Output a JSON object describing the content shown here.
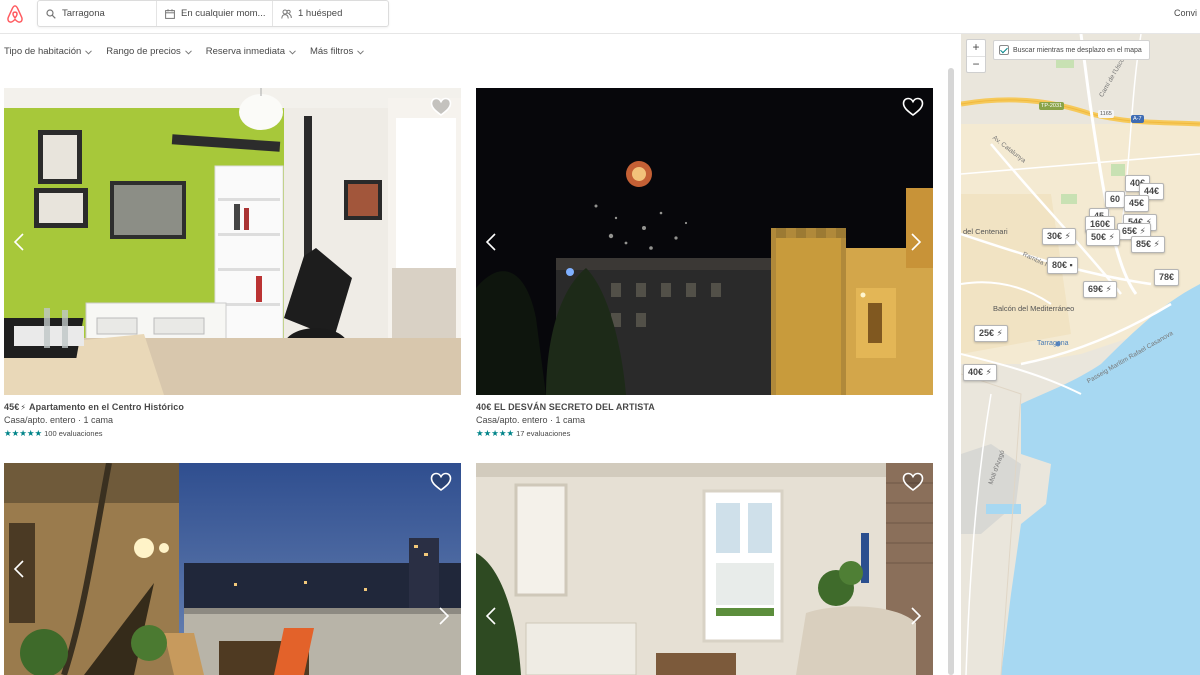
{
  "header": {
    "search": {
      "location": "Tarragona",
      "dates": "En cualquier mom...",
      "guests": "1 huésped"
    },
    "right_link": "Convi"
  },
  "filters": [
    {
      "label": "Tipo de habitación"
    },
    {
      "label": "Rango de precios"
    },
    {
      "label": "Reserva inmediata"
    },
    {
      "label": "Más filtros"
    }
  ],
  "listings": [
    {
      "price": "45€",
      "instant": true,
      "title": "Apartamento en el Centro Histórico",
      "type_beds": "Casa/apto. entero · 1 cama",
      "stars": "★★★★★",
      "reviews": "100 evaluaciones"
    },
    {
      "price": "40€",
      "instant": false,
      "title": "EL DESVÁN SECRETO DEL ARTISTA",
      "type_beds": "Casa/apto. entero · 1 cama",
      "stars": "★★★★★",
      "reviews": "17 evaluaciones"
    },
    {
      "title": ""
    },
    {
      "title": ""
    }
  ],
  "map": {
    "zoom_in": "+",
    "zoom_out": "−",
    "search_toggle": "Buscar mientras me desplazo en el mapa",
    "search_toggle_checked": true,
    "pins": [
      {
        "label": "40€"
      },
      {
        "label": "44€"
      },
      {
        "label": "60"
      },
      {
        "label": "45€"
      },
      {
        "label": "45"
      },
      {
        "label": "54€ ⚡"
      },
      {
        "label": "160€"
      },
      {
        "label": "65€ ⚡"
      },
      {
        "label": "30€ ⚡"
      },
      {
        "label": "50€ ⚡"
      },
      {
        "label": "85€ ⚡"
      },
      {
        "label": "80€ ▪"
      },
      {
        "label": "78€"
      },
      {
        "label": "69€ ⚡"
      },
      {
        "label": "25€ ⚡"
      },
      {
        "label": "40€ ⚡"
      }
    ],
    "labels": {
      "centenari": "del Centenari",
      "balcon": "Balcón del Mediterráneo",
      "tarragona": "Tarragona",
      "rambla": "Rambla Nova",
      "catalunya": "Av. Catalunya",
      "uscola": "Camí de l'Uscola",
      "moll": "Moll d'Aragó",
      "passeig": "Passeig Marítim Rafael Casanova",
      "tp2031": "TP-2031",
      "a7": "A-7",
      "n1165": "1165"
    }
  },
  "colors": {
    "teal": "#008489",
    "brand": "#FF5A5F",
    "sea": "#a7d8f2",
    "map_land": "#e9e5dc",
    "highway": "#f6c95a"
  }
}
